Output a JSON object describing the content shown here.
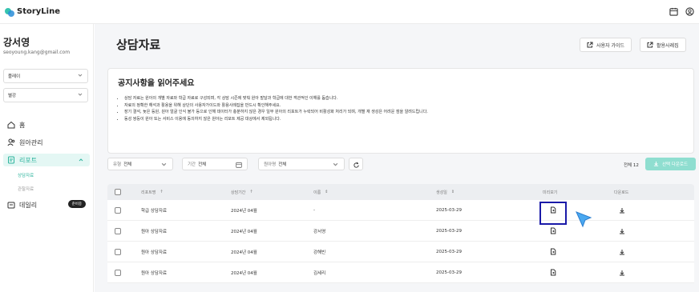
{
  "app": {
    "name": "StoryLine"
  },
  "colors": {
    "accent": "#2bb39c",
    "highlight": "#1a1aa8",
    "button_disabled": "#8fded0"
  },
  "user": {
    "name": "강서영",
    "email": "seoyoung.kang@gmail.com"
  },
  "sidebar": {
    "selects": [
      {
        "value": "플레이"
      },
      {
        "value": "별강"
      }
    ],
    "nav": [
      {
        "label": "홈",
        "icon": "home-icon"
      },
      {
        "label": "원아관리",
        "icon": "users-icon"
      },
      {
        "label": "리포트",
        "icon": "report-icon"
      },
      {
        "label": "데일리",
        "icon": "daily-icon",
        "badge": "준비중"
      }
    ],
    "sub": [
      {
        "label": "상담자료"
      },
      {
        "label": "관찰자료"
      }
    ]
  },
  "page": {
    "title": "상담자료"
  },
  "header_buttons": {
    "guide": "사용자 가이드",
    "examples": "활용사례집"
  },
  "notice": {
    "title": "공지사항을 읽어주세요",
    "items": [
      "상담 자료는 원아의 개별 자료와 학급 자료로 구성되며, 각 상담 시즌에 맞춰 원아 발달과 학급에 대한 객관적인 이해를 돕습니다.",
      "자료의 정확한 해석과 활용을 위해 상단의 사용자가이드와 활용사례집을 반드시 확인해주세요.",
      "장기 결석, 늦은 등원, 원아 얼굴 인식 불가 등으로 인해 데이터가 충분하지 않은 경우 일부 원아의 리포트가 누락되어 비활성화 처리가 되며, 개별 재 생성은 어려운 점을 알려드립니다.",
      "동성 쌍둥이 원아 또는 서비스 이용에 동의하지 않은 원아는 리포트 제공 대상에서 제외됩니다."
    ]
  },
  "filters": {
    "type": {
      "label": "유형",
      "value": "전체"
    },
    "period": {
      "label": "기간",
      "value": "전체"
    },
    "child": {
      "label": "원아명",
      "value": "전체"
    }
  },
  "total": "전체 12",
  "download_selected": "선택 다운로드",
  "table": {
    "headers": {
      "report": "리포트명",
      "period": "상담기간",
      "name": "이름",
      "created": "생성일",
      "preview": "미리보기",
      "download": "다운로드"
    },
    "rows": [
      {
        "report": "학급 상담자료",
        "period": "2024년 04월",
        "name": "-",
        "created": "2025-03-29"
      },
      {
        "report": "원아 상담자료",
        "period": "2024년 04월",
        "name": "강서영",
        "created": "2025-03-29"
      },
      {
        "report": "원아 상담자료",
        "period": "2024년 04월",
        "name": "강해빈",
        "created": "2025-03-29"
      },
      {
        "report": "원아 상담자료",
        "period": "2024년 04월",
        "name": "김세리",
        "created": "2025-03-29"
      }
    ]
  }
}
